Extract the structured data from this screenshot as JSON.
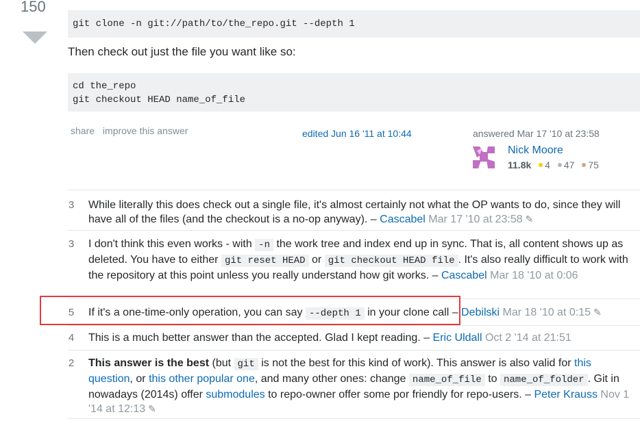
{
  "answer": {
    "vote_count": "150",
    "code_block_1": "git clone -n git://path/to/the_repo.git --depth 1",
    "prose_text": "Then check out just the file you want like so:",
    "code_block_2_lines": [
      "cd the_repo",
      "git checkout HEAD name_of_file"
    ],
    "menu": {
      "share": "share",
      "improve": "improve this answer"
    },
    "edited": "edited Jun 16 '11 at 10:44",
    "answered": "answered Mar 17 '10 at 23:58",
    "user": {
      "name": "Nick Moore",
      "reputation": "11.8k",
      "gold": "4",
      "silver": "47",
      "bronze": "75",
      "gold_color": "#ffcc01",
      "silver_color": "#b4b8bc",
      "bronze_color": "#d1a684"
    }
  },
  "comments": [
    {
      "score": "3",
      "text": "While literally this does check out a single file, it's almost certainly not what the OP wants to do, since they will have all of the files (and the checkout is a no-op anyway). –",
      "user": "Cascabel",
      "date": "Mar 17 '10 at 23:58"
    },
    {
      "score": "3",
      "text_1": "I don't think this even works - with",
      "code_1": "-n",
      "text_2": "the work tree and index end up in sync. That is, all content shows up as deleted. You have to either",
      "code_2": "git reset HEAD",
      "text_3": "or",
      "code_3": "git checkout HEAD file",
      "text_4": ". It's also really difficult to work with the repository at this point unless you really understand how git works. –",
      "user": "Cascabel",
      "date": "Mar 18 '10 at 0:06"
    },
    {
      "score": "5",
      "text_1": "If it's a one-time-only operation, you can say",
      "code_1": "--depth 1",
      "text_2": "in your clone call –",
      "user": "Debilski",
      "date": "Mar 18 '10 at 0:15"
    },
    {
      "score": "4",
      "text": "This is a much better answer than the accepted. Glad I kept reading. –",
      "user": "Eric Uldall",
      "date": "Oct 2 '14 at 21:51"
    },
    {
      "score": "2",
      "bold": "This answer is the best",
      "text_1": " (but",
      "code_1": "git",
      "text_2": "is not the best for this kind of work). This answer is also valid for",
      "link_1": "this question",
      "text_3": ", or",
      "link_2": "this other popular one",
      "text_4": ", and many other ones: change",
      "code_2": "name_of_file",
      "text_5": "to",
      "code_3": "name_of_folder",
      "text_6": ". Git in nowadays (2014s) offer",
      "link_3": "submodules",
      "text_7": "to repo-owner offer some por friendly for repo-users. –",
      "user": "Peter Krauss",
      "date": "Nov 1 '14 at 12:13"
    }
  ],
  "colors": {
    "link": "#0c6ab4",
    "highlight": "#e23a3a"
  },
  "icons": {
    "pencil": "pencil-icon",
    "vote_down": "arrow-down-icon"
  }
}
